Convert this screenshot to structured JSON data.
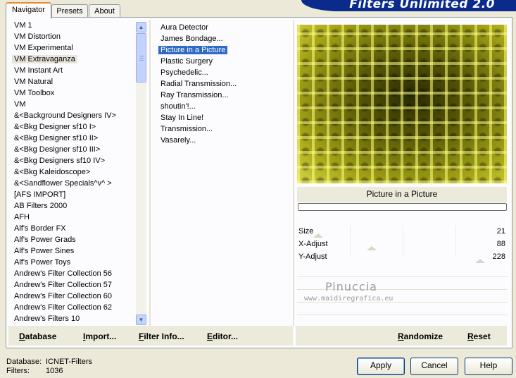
{
  "tabs": [
    {
      "label": "Navigator",
      "active": true
    },
    {
      "label": "Presets",
      "active": false
    },
    {
      "label": "About",
      "active": false
    }
  ],
  "banner_title": "Filters Unlimited 2.0",
  "categories": [
    "VM 1",
    "VM Distortion",
    "VM Experimental",
    "VM Extravaganza",
    "VM Instant Art",
    "VM Natural",
    "VM Toolbox",
    "VM",
    "&<Background Designers IV>",
    "&<Bkg Designer sf10 I>",
    "&<Bkg Designer sf10 II>",
    "&<Bkg Designer sf10 III>",
    "&<Bkg Designers sf10 IV>",
    "&<Bkg Kaleidoscope>",
    "&<Sandflower Specials^v^ >",
    "[AFS IMPORT]",
    "AB Filters 2000",
    "AFH",
    "Alf's Border FX",
    "Alf's Power Grads",
    "Alf's Power Sines",
    "Alf's Power Toys",
    "Andrew's Filter Collection 56",
    "Andrew's Filter Collection 57",
    "Andrew's Filter Collection 60",
    "Andrew's Filter Collection 62",
    "Andrew's Filters 10"
  ],
  "selected_category": "VM Extravaganza",
  "filters": [
    "Aura Detector",
    "James Bondage...",
    "Picture in a Picture",
    "Plastic Surgery",
    "Psychedelic...",
    "Radial Transmission...",
    "Ray Transmission...",
    "shoutin'!...",
    "Stay In Line!",
    "Transmission...",
    "Vasarely..."
  ],
  "selected_filter": "Picture in a Picture",
  "preview_title": "Picture in a Picture",
  "params": [
    {
      "label": "Size",
      "value": "21",
      "level": 0.08
    },
    {
      "label": "X-Adjust",
      "value": "88",
      "level": 0.35
    },
    {
      "label": "Y-Adjust",
      "value": "228",
      "level": 0.89
    }
  ],
  "watermark": {
    "name": "Pinuccia",
    "url": "www.maidiregrafica.eu"
  },
  "panel_buttons": {
    "database": "Database",
    "import": "Import...",
    "filter_info": "Filter Info...",
    "editor": "Editor...",
    "randomize": "Randomize",
    "reset": "Reset"
  },
  "status": {
    "database_label": "Database:",
    "database_value": "ICNET-Filters",
    "filters_label": "Filters:",
    "filters_value": "1036"
  },
  "dialog_buttons": {
    "apply": "Apply",
    "cancel": "Cancel",
    "help": "Help"
  },
  "colors": {
    "selection": "#316ac5",
    "banner": "#0a2a8c",
    "tab_highlight": "#e68b2c"
  }
}
